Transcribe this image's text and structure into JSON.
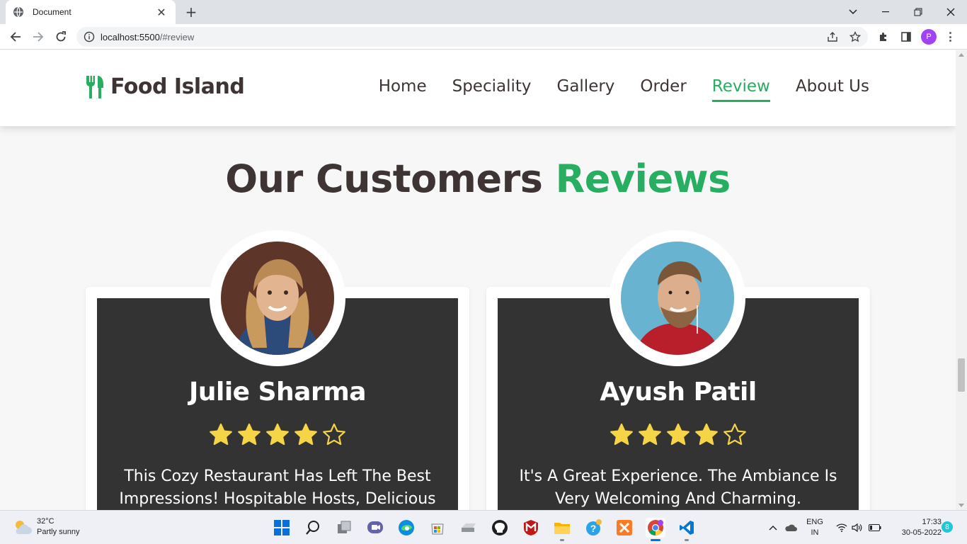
{
  "browser": {
    "tab_title": "Document",
    "new_tab_label": "+",
    "url_host": "localhost:5500",
    "url_path": "/#review",
    "profile_initial": "P"
  },
  "site": {
    "brand": "Food Island",
    "nav": [
      {
        "label": "Home",
        "active": false
      },
      {
        "label": "Speciality",
        "active": false
      },
      {
        "label": "Gallery",
        "active": false
      },
      {
        "label": "Order",
        "active": false
      },
      {
        "label": "Review",
        "active": true
      },
      {
        "label": "About Us",
        "active": false
      }
    ],
    "accent_color": "#27ae60",
    "text_color": "#3f3434"
  },
  "reviews": {
    "title_main": "Our Customers",
    "title_accent": "Reviews",
    "items": [
      {
        "name": "Julie Sharma",
        "rating": 4,
        "max_rating": 5,
        "text": "This Cozy Restaurant Has Left The Best Impressions! Hospitable Hosts, Delicious"
      },
      {
        "name": "Ayush Patil",
        "rating": 4,
        "max_rating": 5,
        "text": "It's A Great Experience. The Ambiance Is Very Welcoming And Charming."
      }
    ],
    "star_color": "#f5d547"
  },
  "taskbar": {
    "weather_temp": "32°C",
    "weather_desc": "Partly sunny",
    "lang_1": "ENG",
    "lang_2": "IN",
    "time": "17:33",
    "date": "30-05-2022",
    "notification_count": "8"
  }
}
